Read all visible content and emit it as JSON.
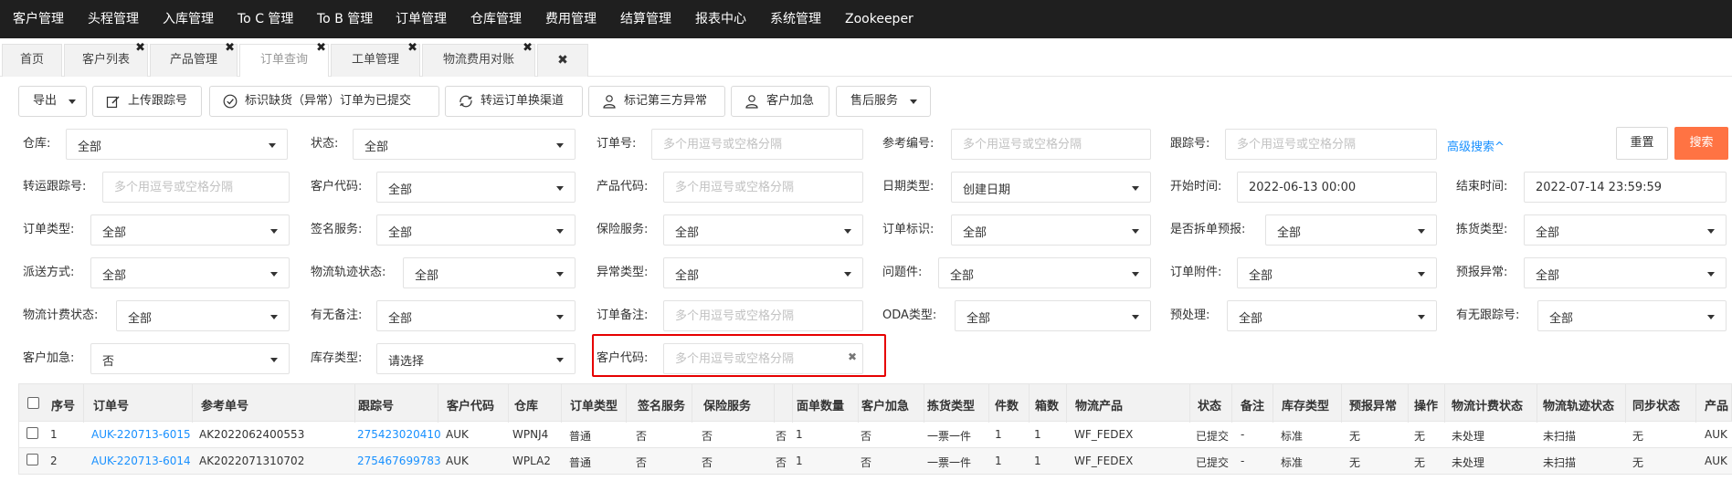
{
  "nav": [
    "客户管理",
    "头程管理",
    "入库管理",
    "To C 管理",
    "To B 管理",
    "订单管理",
    "仓库管理",
    "费用管理",
    "结算管理",
    "报表中心",
    "系统管理",
    "Zookeeper"
  ],
  "tabs": [
    "首页",
    "客户列表",
    "产品管理",
    "订单查询",
    "工单管理",
    "物流费用对账"
  ],
  "tab_close_glyph": "✖",
  "toolbar": {
    "export": "导出",
    "upload_tracking": "上传跟踪号",
    "mark_submitted": "标识缺货（异常）订单为已提交",
    "switch_channel": "转运订单换渠道",
    "mark_third_party": "标记第三方异常",
    "customer_urgent": "客户加急",
    "after_sales": "售后服务"
  },
  "filters": {
    "warehouse": {
      "label": "仓库:",
      "value": "全部"
    },
    "status": {
      "label": "状态:",
      "value": "全部"
    },
    "order_no": {
      "label": "订单号:",
      "placeholder": "多个用逗号或空格分隔"
    },
    "ref_no": {
      "label": "参考编号:",
      "placeholder": "多个用逗号或空格分隔"
    },
    "tracking_no": {
      "label": "跟踪号:",
      "placeholder": "多个用逗号或空格分隔"
    },
    "transfer_tracking": {
      "label": "转运跟踪号:",
      "placeholder": "多个用逗号或空格分隔"
    },
    "customer_code": {
      "label": "客户代码:",
      "value": "全部"
    },
    "product_code": {
      "label": "产品代码:",
      "placeholder": "多个用逗号或空格分隔"
    },
    "date_type": {
      "label": "日期类型:",
      "value": "创建日期"
    },
    "start_time": {
      "label": "开始时间:",
      "value": "2022-06-13 00:00"
    },
    "end_time": {
      "label": "结束时间:",
      "value": "2022-07-14 23:59:59"
    },
    "order_type": {
      "label": "订单类型:",
      "value": "全部"
    },
    "sign_service": {
      "label": "签名服务:",
      "value": "全部"
    },
    "insurance": {
      "label": "保险服务:",
      "value": "全部"
    },
    "order_mark": {
      "label": "订单标识:",
      "value": "全部"
    },
    "split_forecast": {
      "label": "是否拆单预报:",
      "value": "全部"
    },
    "picking_type": {
      "label": "拣货类型:",
      "value": "全部"
    },
    "delivery_method": {
      "label": "派送方式:",
      "value": "全部"
    },
    "logistics_track": {
      "label": "物流轨迹状态:",
      "value": "全部"
    },
    "exception_type": {
      "label": "异常类型:",
      "value": "全部"
    },
    "problem_item": {
      "label": "问题件:",
      "value": "全部"
    },
    "order_attachment": {
      "label": "订单附件:",
      "value": "全部"
    },
    "forecast_exception": {
      "label": "预报异常:",
      "value": "全部"
    },
    "logistics_fee_status": {
      "label": "物流计费状态:",
      "value": "全部"
    },
    "has_remark": {
      "label": "有无备注:",
      "value": "全部"
    },
    "order_remark": {
      "label": "订单备注:",
      "placeholder": "多个用逗号或空格分隔"
    },
    "oda_type": {
      "label": "ODA类型:",
      "value": "全部"
    },
    "preprocess": {
      "label": "预处理:",
      "value": "全部"
    },
    "has_tracking": {
      "label": "有无跟踪号:",
      "value": "全部"
    },
    "customer_urgent": {
      "label": "客户加急:",
      "value": "否"
    },
    "stock_type": {
      "label": "库存类型:",
      "value": "请选择"
    },
    "customer_code2": {
      "label": "客户代码:",
      "placeholder": "多个用逗号或空格分隔"
    }
  },
  "advanced_search": "高级搜索^",
  "reset": "重置",
  "search": "搜索",
  "clear_glyph": "✖",
  "table": {
    "headers": [
      "序号",
      "订单号",
      "参考单号",
      "跟踪号",
      "客户代码",
      "仓库",
      "订单类型",
      "签名服务",
      "保险服务",
      "面单数量",
      "客户加急",
      "拣货类型",
      "件数",
      "箱数",
      "物流产品",
      "状态",
      "备注",
      "库存类型",
      "预报异常",
      "操作",
      "物流计费状态",
      "物流轨迹状态",
      "同步状态",
      "产品"
    ],
    "rows": [
      [
        "1",
        "AUK-220713-6015",
        "AK2022062400553",
        "275423020410",
        "AUK",
        "WPNJ4",
        "普通",
        "否",
        "否",
        "否",
        "1",
        "否",
        "一票一件",
        "1",
        "1",
        "WF_FEDEX",
        "已提交",
        "-",
        "标准",
        "无",
        "无",
        "未处理",
        "未扫描",
        "无",
        "AUK"
      ],
      [
        "2",
        "AUK-220713-6014",
        "AK2022071310702",
        "275467699783",
        "AUK",
        "WPLA2",
        "普通",
        "否",
        "否",
        "否",
        "1",
        "否",
        "一票一件",
        "1",
        "1",
        "WF_FEDEX",
        "已提交",
        "-",
        "标准",
        "无",
        "无",
        "未处理",
        "未扫描",
        "无",
        "AUK"
      ]
    ]
  }
}
